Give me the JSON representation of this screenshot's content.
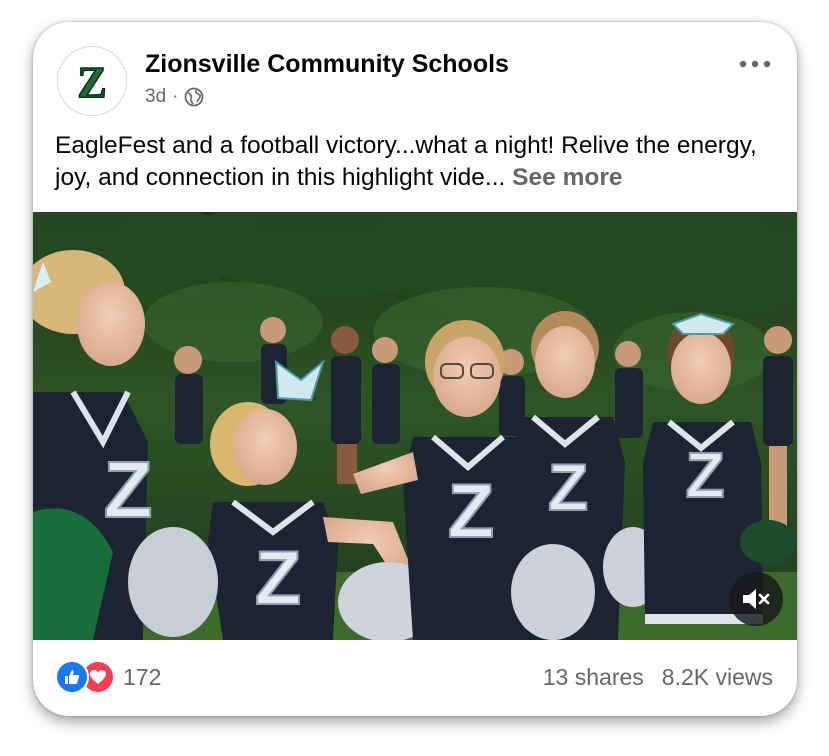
{
  "post": {
    "page_name": "Zionsville Community Schools",
    "avatar_letter": "Z",
    "time": "3d",
    "separator": "·",
    "audience_icon": "globe-icon",
    "more_icon": "more-options-icon",
    "caption": "EagleFest and a football victory...what a night! Relive the energy, joy, and connection in this highlight vide... ",
    "see_more": "See more"
  },
  "video": {
    "jersey_letter": "Z",
    "mute_icon": "muted-speaker-icon"
  },
  "footer": {
    "reaction_icons": [
      "like-icon",
      "love-icon"
    ],
    "reaction_count": "172",
    "shares": "13 shares",
    "views": "8.2K views"
  },
  "colors": {
    "brand_green": "#1e6b3a",
    "like_blue": "#1877f2",
    "love_red": "#f33e58",
    "secondary_text": "#65676b"
  }
}
